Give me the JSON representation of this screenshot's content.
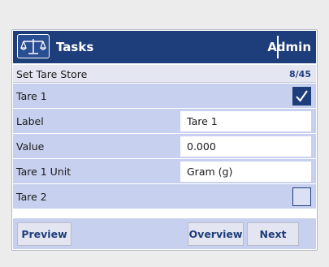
{
  "header": {
    "title": "Tasks",
    "user": "Admin"
  },
  "subheader": {
    "breadcrumb": "Set Tare Store",
    "page_indicator": "8/45"
  },
  "rows": [
    {
      "label": "Tare 1",
      "type": "checkbox",
      "checked": true
    },
    {
      "label": "Label",
      "type": "field",
      "value": "Tare 1"
    },
    {
      "label": "Value",
      "type": "field",
      "value": "0.000"
    },
    {
      "label": "Tare 1 Unit",
      "type": "field",
      "value": "Gram (g)"
    },
    {
      "label": "Tare 2",
      "type": "checkbox",
      "checked": false
    }
  ],
  "footer": {
    "preview_label": "Preview",
    "overview_label": "Overview",
    "next_label": "Next"
  },
  "colors": {
    "primary": "#1e3d7b",
    "row_bg": "#c7d0ee",
    "page_bg": "#ececec"
  },
  "icons": {
    "logo": "balance-scale-icon",
    "check": "checkmark-icon"
  }
}
